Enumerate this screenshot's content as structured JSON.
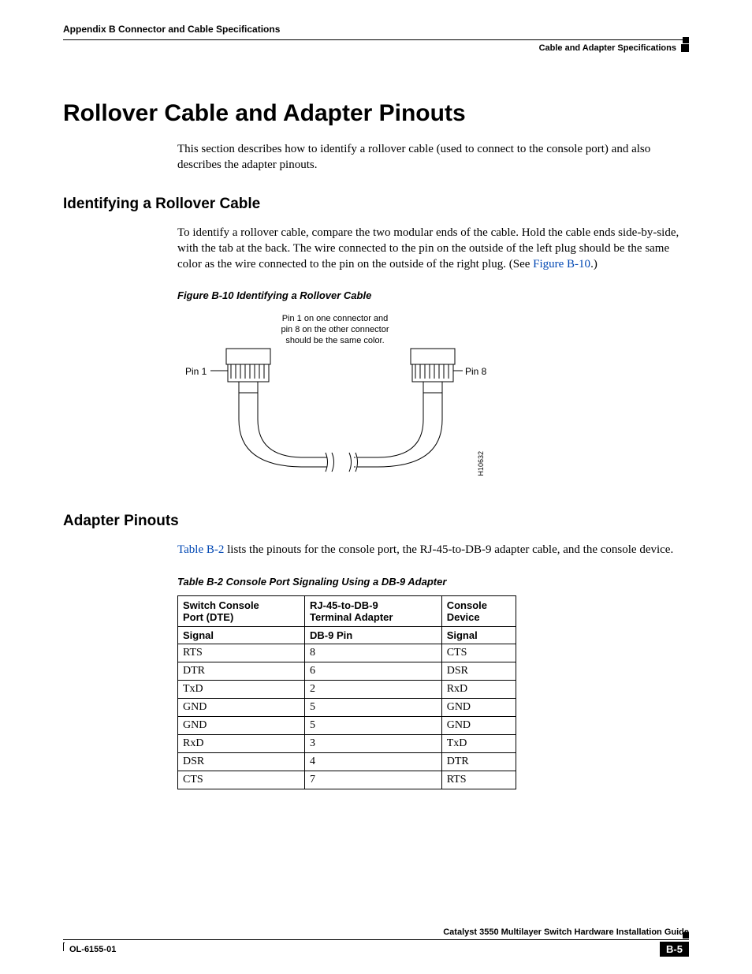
{
  "header": {
    "left": "Appendix B    Connector and Cable Specifications",
    "right": "Cable and Adapter Specifications"
  },
  "title": "Rollover Cable and Adapter Pinouts",
  "intro": "This section describes how to identify a rollover cable (used to connect to the console port) and also describes the adapter pinouts.",
  "section1": {
    "heading": "Identifying a Rollover Cable",
    "para_a": "To identify a rollover cable, compare the two modular ends of the cable. Hold the cable ends side-by-side, with the tab at the back. The wire connected to the pin on the outside of the left plug should be the same color as the wire connected to the pin on the outside of the right plug. (See ",
    "para_link": "Figure B-10",
    "para_b": ".)",
    "figure_caption": "Figure B-10   Identifying a Rollover Cable",
    "fig_text1": "Pin 1 on one connector and",
    "fig_text2": "pin 8 on the other connector",
    "fig_text3": "should be the same color.",
    "pin1_label": "Pin 1",
    "pin8_label": "Pin 8",
    "fig_id": "H10632"
  },
  "section2": {
    "heading": "Adapter Pinouts",
    "para_link": "Table B-2",
    "para_rest": " lists the pinouts for the console port, the RJ-45-to-DB-9 adapter cable, and the console device.",
    "table_caption": "Table B-2     Console Port Signaling Using a DB-9 Adapter",
    "headers": {
      "c1a": "Switch Console",
      "c1b": "Port (DTE)",
      "c2a": "RJ-45-to-DB-9",
      "c2b": "Terminal Adapter",
      "c3a": "Console",
      "c3b": "Device",
      "s1": "Signal",
      "s2": "DB-9 Pin",
      "s3": "Signal"
    },
    "rows": [
      {
        "a": "RTS",
        "b": "8",
        "c": "CTS"
      },
      {
        "a": "DTR",
        "b": "6",
        "c": "DSR"
      },
      {
        "a": "TxD",
        "b": "2",
        "c": "RxD"
      },
      {
        "a": "GND",
        "b": "5",
        "c": "GND"
      },
      {
        "a": "GND",
        "b": "5",
        "c": "GND"
      },
      {
        "a": "RxD",
        "b": "3",
        "c": "TxD"
      },
      {
        "a": "DSR",
        "b": "4",
        "c": "DTR"
      },
      {
        "a": "CTS",
        "b": "7",
        "c": "RTS"
      }
    ]
  },
  "footer": {
    "guide": "Catalyst 3550 Multilayer Switch Hardware Installation Guide",
    "docnum": "OL-6155-01",
    "pagenum": "B-5"
  }
}
